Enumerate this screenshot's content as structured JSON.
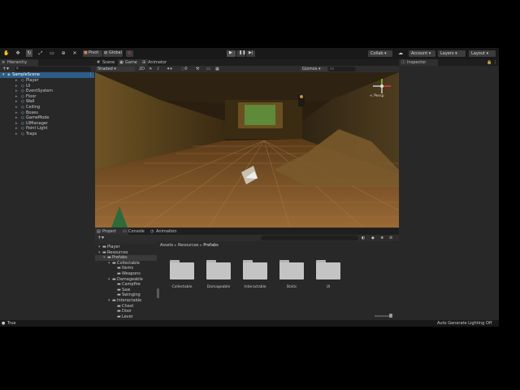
{
  "toolbar": {
    "pivot": "Pivot",
    "global": "Global",
    "collab": "Collab ▾",
    "account": "Account",
    "layers": "Layers",
    "layout": "Layout"
  },
  "hierarchy": {
    "tab": "Hierarchy",
    "scene": "SampleScene",
    "items": [
      "Player",
      "UI",
      "EventSystem",
      "Floor",
      "Wall",
      "Ceiling",
      "Boxes",
      "GameMode",
      "UIManager",
      "Point Light",
      "Traps"
    ]
  },
  "view": {
    "tabs": [
      "Scene",
      "Game",
      "Animator"
    ],
    "shading": "Shaded",
    "mode": "2D",
    "gizmos": "Gizmos",
    "search_placeholder": "All",
    "gizmo_label": "< Persp"
  },
  "inspector": {
    "tab": "Inspector"
  },
  "project": {
    "tabs": [
      "Project",
      "Console",
      "Animation"
    ],
    "breadcrumb": [
      "Assets",
      "Resources",
      "Prefabs"
    ],
    "tree": [
      {
        "label": "Player",
        "indent": 0
      },
      {
        "label": "Resources",
        "indent": 0
      },
      {
        "label": "Prefabs",
        "indent": 1
      },
      {
        "label": "Collectable",
        "indent": 2
      },
      {
        "label": "Items",
        "indent": 3
      },
      {
        "label": "Weapons",
        "indent": 3
      },
      {
        "label": "Damageable",
        "indent": 2
      },
      {
        "label": "Campfire",
        "indent": 3
      },
      {
        "label": "Saw",
        "indent": 3
      },
      {
        "label": "Swinging",
        "indent": 3
      },
      {
        "label": "Interactable",
        "indent": 2
      },
      {
        "label": "Chest",
        "indent": 3
      },
      {
        "label": "Door",
        "indent": 3
      },
      {
        "label": "Lever",
        "indent": 3
      }
    ],
    "folders": [
      "Collectable",
      "Damageable",
      "Interactable",
      "Static",
      "UI"
    ]
  },
  "status": {
    "left": "True",
    "right": "Auto Generate Lighting Off"
  }
}
